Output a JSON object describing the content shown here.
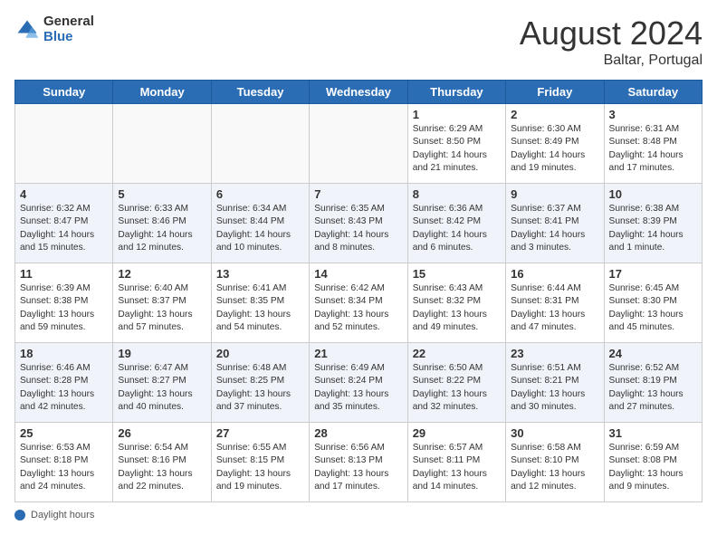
{
  "header": {
    "logo_general": "General",
    "logo_blue": "Blue",
    "month_year": "August 2024",
    "location": "Baltar, Portugal"
  },
  "footer": {
    "label": "Daylight hours"
  },
  "weekdays": [
    "Sunday",
    "Monday",
    "Tuesday",
    "Wednesday",
    "Thursday",
    "Friday",
    "Saturday"
  ],
  "weeks": [
    [
      {
        "day": "",
        "info": "",
        "empty": true
      },
      {
        "day": "",
        "info": "",
        "empty": true
      },
      {
        "day": "",
        "info": "",
        "empty": true
      },
      {
        "day": "",
        "info": "",
        "empty": true
      },
      {
        "day": "1",
        "info": "Sunrise: 6:29 AM\nSunset: 8:50 PM\nDaylight: 14 hours\nand 21 minutes."
      },
      {
        "day": "2",
        "info": "Sunrise: 6:30 AM\nSunset: 8:49 PM\nDaylight: 14 hours\nand 19 minutes."
      },
      {
        "day": "3",
        "info": "Sunrise: 6:31 AM\nSunset: 8:48 PM\nDaylight: 14 hours\nand 17 minutes."
      }
    ],
    [
      {
        "day": "4",
        "info": "Sunrise: 6:32 AM\nSunset: 8:47 PM\nDaylight: 14 hours\nand 15 minutes."
      },
      {
        "day": "5",
        "info": "Sunrise: 6:33 AM\nSunset: 8:46 PM\nDaylight: 14 hours\nand 12 minutes."
      },
      {
        "day": "6",
        "info": "Sunrise: 6:34 AM\nSunset: 8:44 PM\nDaylight: 14 hours\nand 10 minutes."
      },
      {
        "day": "7",
        "info": "Sunrise: 6:35 AM\nSunset: 8:43 PM\nDaylight: 14 hours\nand 8 minutes."
      },
      {
        "day": "8",
        "info": "Sunrise: 6:36 AM\nSunset: 8:42 PM\nDaylight: 14 hours\nand 6 minutes."
      },
      {
        "day": "9",
        "info": "Sunrise: 6:37 AM\nSunset: 8:41 PM\nDaylight: 14 hours\nand 3 minutes."
      },
      {
        "day": "10",
        "info": "Sunrise: 6:38 AM\nSunset: 8:39 PM\nDaylight: 14 hours\nand 1 minute."
      }
    ],
    [
      {
        "day": "11",
        "info": "Sunrise: 6:39 AM\nSunset: 8:38 PM\nDaylight: 13 hours\nand 59 minutes."
      },
      {
        "day": "12",
        "info": "Sunrise: 6:40 AM\nSunset: 8:37 PM\nDaylight: 13 hours\nand 57 minutes."
      },
      {
        "day": "13",
        "info": "Sunrise: 6:41 AM\nSunset: 8:35 PM\nDaylight: 13 hours\nand 54 minutes."
      },
      {
        "day": "14",
        "info": "Sunrise: 6:42 AM\nSunset: 8:34 PM\nDaylight: 13 hours\nand 52 minutes."
      },
      {
        "day": "15",
        "info": "Sunrise: 6:43 AM\nSunset: 8:32 PM\nDaylight: 13 hours\nand 49 minutes."
      },
      {
        "day": "16",
        "info": "Sunrise: 6:44 AM\nSunset: 8:31 PM\nDaylight: 13 hours\nand 47 minutes."
      },
      {
        "day": "17",
        "info": "Sunrise: 6:45 AM\nSunset: 8:30 PM\nDaylight: 13 hours\nand 45 minutes."
      }
    ],
    [
      {
        "day": "18",
        "info": "Sunrise: 6:46 AM\nSunset: 8:28 PM\nDaylight: 13 hours\nand 42 minutes."
      },
      {
        "day": "19",
        "info": "Sunrise: 6:47 AM\nSunset: 8:27 PM\nDaylight: 13 hours\nand 40 minutes."
      },
      {
        "day": "20",
        "info": "Sunrise: 6:48 AM\nSunset: 8:25 PM\nDaylight: 13 hours\nand 37 minutes."
      },
      {
        "day": "21",
        "info": "Sunrise: 6:49 AM\nSunset: 8:24 PM\nDaylight: 13 hours\nand 35 minutes."
      },
      {
        "day": "22",
        "info": "Sunrise: 6:50 AM\nSunset: 8:22 PM\nDaylight: 13 hours\nand 32 minutes."
      },
      {
        "day": "23",
        "info": "Sunrise: 6:51 AM\nSunset: 8:21 PM\nDaylight: 13 hours\nand 30 minutes."
      },
      {
        "day": "24",
        "info": "Sunrise: 6:52 AM\nSunset: 8:19 PM\nDaylight: 13 hours\nand 27 minutes."
      }
    ],
    [
      {
        "day": "25",
        "info": "Sunrise: 6:53 AM\nSunset: 8:18 PM\nDaylight: 13 hours\nand 24 minutes."
      },
      {
        "day": "26",
        "info": "Sunrise: 6:54 AM\nSunset: 8:16 PM\nDaylight: 13 hours\nand 22 minutes."
      },
      {
        "day": "27",
        "info": "Sunrise: 6:55 AM\nSunset: 8:15 PM\nDaylight: 13 hours\nand 19 minutes."
      },
      {
        "day": "28",
        "info": "Sunrise: 6:56 AM\nSunset: 8:13 PM\nDaylight: 13 hours\nand 17 minutes."
      },
      {
        "day": "29",
        "info": "Sunrise: 6:57 AM\nSunset: 8:11 PM\nDaylight: 13 hours\nand 14 minutes."
      },
      {
        "day": "30",
        "info": "Sunrise: 6:58 AM\nSunset: 8:10 PM\nDaylight: 13 hours\nand 12 minutes."
      },
      {
        "day": "31",
        "info": "Sunrise: 6:59 AM\nSunset: 8:08 PM\nDaylight: 13 hours\nand 9 minutes."
      }
    ]
  ]
}
